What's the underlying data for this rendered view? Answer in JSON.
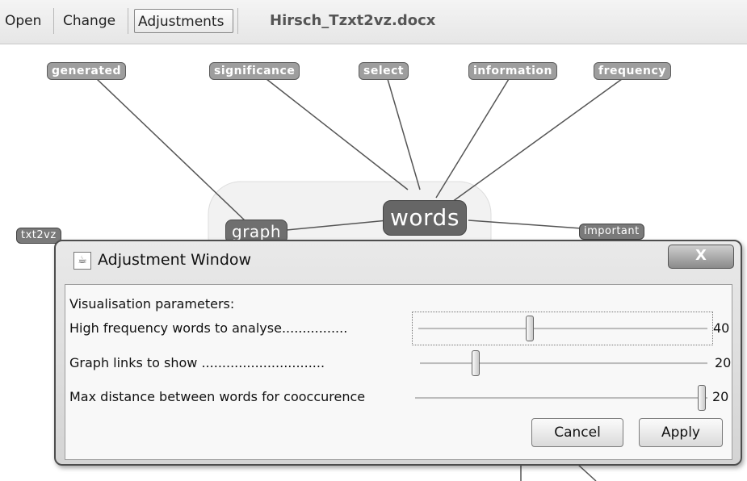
{
  "toolbar": {
    "open_label": "Open",
    "change_label": "Change",
    "adjustments_label": "Adjustments",
    "document_title": "Hirsch_Tzxt2vz.docx"
  },
  "graph": {
    "center_node": "words",
    "nodes": {
      "generated": "generated",
      "significance": "significance",
      "select": "select",
      "information": "information",
      "frequency": "frequency",
      "graph": "graph",
      "important": "important",
      "txt2vz": "txt2vz"
    }
  },
  "dialog": {
    "title": "Adjustment Window",
    "close_label": "X",
    "section_label": "Visualisation parameters:",
    "sliders": [
      {
        "label": "High frequency words to analyse................",
        "value": "40",
        "fraction": 0.4
      },
      {
        "label": "Graph links to show ..............................",
        "value": "20",
        "fraction": 0.2
      },
      {
        "label": "Max distance between words for cooccurence",
        "value": "20",
        "fraction": 1.0
      }
    ],
    "cancel_label": "Cancel",
    "apply_label": "Apply"
  }
}
